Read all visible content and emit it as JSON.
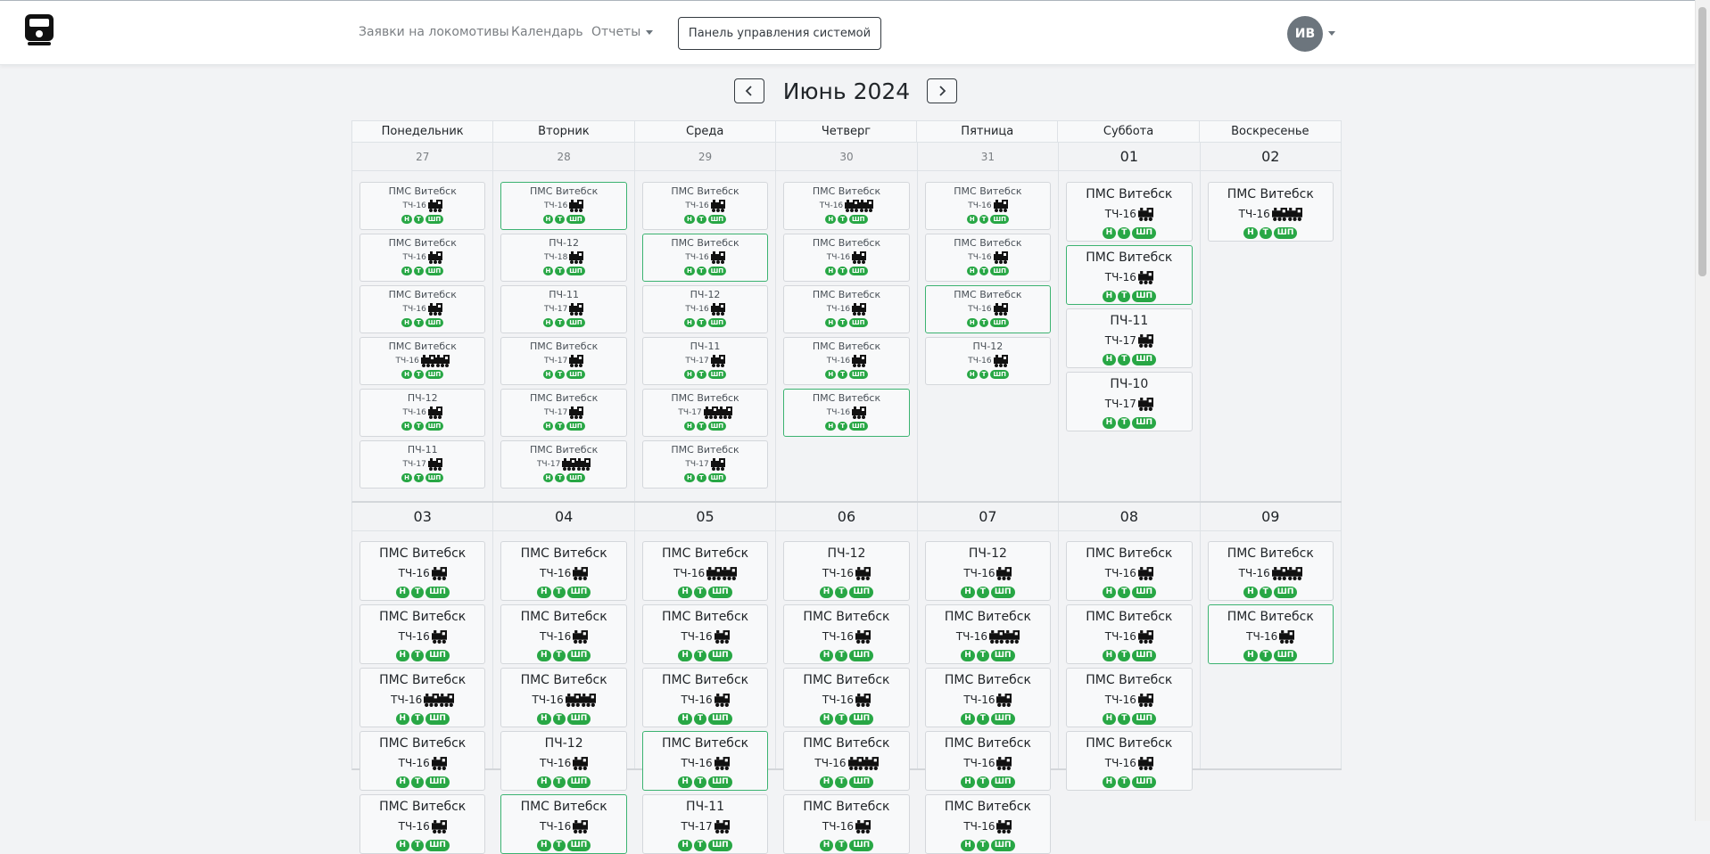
{
  "nav": {
    "links": [
      "Заявки на локомотивы",
      "Календарь",
      "Отчеты"
    ],
    "system_button": "Панель управления системой",
    "avatar": "ИВ",
    "logo_icon": "train-logo-icon"
  },
  "month": {
    "title": "Июнь 2024",
    "prev_icon": "chevron-left-icon",
    "next_icon": "chevron-right-icon"
  },
  "weekdays": [
    "Понедельник",
    "Вторник",
    "Среда",
    "Четверг",
    "Пятница",
    "Суббота",
    "Воскресенье"
  ],
  "badge_labels": [
    "Н",
    "Т",
    "ШП"
  ],
  "colors": {
    "badge": "#28a745",
    "highlight_border": "#3cb371"
  },
  "weeks": [
    {
      "days": [
        {
          "num": "27",
          "other": true,
          "cards": [
            {
              "title": "ПМС Витебск",
              "unit": "ТЧ-16",
              "locos": 1,
              "hl": false
            },
            {
              "title": "ПМС Витебск",
              "unit": "ТЧ-16",
              "locos": 1,
              "hl": false
            },
            {
              "title": "ПМС Витебск",
              "unit": "ТЧ-16",
              "locos": 1,
              "hl": false
            },
            {
              "title": "ПМС Витебск",
              "unit": "ТЧ-16",
              "locos": 2,
              "hl": false
            },
            {
              "title": "ПЧ-12",
              "unit": "ТЧ-16",
              "locos": 1,
              "hl": false
            },
            {
              "title": "ПЧ-11",
              "unit": "ТЧ-17",
              "locos": 1,
              "hl": false
            }
          ]
        },
        {
          "num": "28",
          "other": true,
          "cards": [
            {
              "title": "ПМС Витебск",
              "unit": "ТЧ-16",
              "locos": 1,
              "hl": true
            },
            {
              "title": "ПЧ-12",
              "unit": "ТЧ-18",
              "locos": 1,
              "hl": false
            },
            {
              "title": "ПЧ-11",
              "unit": "ТЧ-17",
              "locos": 1,
              "hl": false
            },
            {
              "title": "ПМС Витебск",
              "unit": "ТЧ-17",
              "locos": 1,
              "hl": false
            },
            {
              "title": "ПМС Витебск",
              "unit": "ТЧ-17",
              "locos": 1,
              "hl": false
            },
            {
              "title": "ПМС Витебск",
              "unit": "ТЧ-17",
              "locos": 2,
              "hl": false
            }
          ]
        },
        {
          "num": "29",
          "other": true,
          "cards": [
            {
              "title": "ПМС Витебск",
              "unit": "ТЧ-16",
              "locos": 1,
              "hl": false
            },
            {
              "title": "ПМС Витебск",
              "unit": "ТЧ-16",
              "locos": 1,
              "hl": true
            },
            {
              "title": "ПЧ-12",
              "unit": "ТЧ-16",
              "locos": 1,
              "hl": false
            },
            {
              "title": "ПЧ-11",
              "unit": "ТЧ-17",
              "locos": 1,
              "hl": false
            },
            {
              "title": "ПМС Витебск",
              "unit": "ТЧ-17",
              "locos": 2,
              "hl": false
            },
            {
              "title": "ПМС Витебск",
              "unit": "ТЧ-17",
              "locos": 1,
              "hl": false
            }
          ]
        },
        {
          "num": "30",
          "other": true,
          "cards": [
            {
              "title": "ПМС Витебск",
              "unit": "ТЧ-16",
              "locos": 2,
              "hl": false
            },
            {
              "title": "ПМС Витебск",
              "unit": "ТЧ-16",
              "locos": 1,
              "hl": false
            },
            {
              "title": "ПМС Витебск",
              "unit": "ТЧ-16",
              "locos": 1,
              "hl": false
            },
            {
              "title": "ПМС Витебск",
              "unit": "ТЧ-16",
              "locos": 1,
              "hl": false
            },
            {
              "title": "ПМС Витебск",
              "unit": "ТЧ-16",
              "locos": 1,
              "hl": true
            }
          ]
        },
        {
          "num": "31",
          "other": true,
          "cards": [
            {
              "title": "ПМС Витебск",
              "unit": "ТЧ-16",
              "locos": 1,
              "hl": false
            },
            {
              "title": "ПМС Витебск",
              "unit": "ТЧ-16",
              "locos": 1,
              "hl": false
            },
            {
              "title": "ПМС Витебск",
              "unit": "ТЧ-16",
              "locos": 1,
              "hl": true
            },
            {
              "title": "ПЧ-12",
              "unit": "ТЧ-16",
              "locos": 1,
              "hl": false
            }
          ]
        },
        {
          "num": "01",
          "other": false,
          "cards": [
            {
              "title": "ПМС Витебск",
              "unit": "ТЧ-16",
              "locos": 1,
              "hl": false
            },
            {
              "title": "ПМС Витебск",
              "unit": "ТЧ-16",
              "locos": 1,
              "hl": true
            },
            {
              "title": "ПЧ-11",
              "unit": "ТЧ-17",
              "locos": 1,
              "hl": false
            },
            {
              "title": "ПЧ-10",
              "unit": "ТЧ-17",
              "locos": 1,
              "hl": false
            }
          ]
        },
        {
          "num": "02",
          "other": false,
          "cards": [
            {
              "title": "ПМС Витебск",
              "unit": "ТЧ-16",
              "locos": 2,
              "hl": false
            }
          ]
        }
      ]
    },
    {
      "days": [
        {
          "num": "03",
          "other": false,
          "cards": [
            {
              "title": "ПМС Витебск",
              "unit": "ТЧ-16",
              "locos": 1,
              "hl": false
            },
            {
              "title": "ПМС Витебск",
              "unit": "ТЧ-16",
              "locos": 1,
              "hl": false
            },
            {
              "title": "ПМС Витебск",
              "unit": "ТЧ-16",
              "locos": 2,
              "hl": false
            },
            {
              "title": "ПМС Витебск",
              "unit": "ТЧ-16",
              "locos": 1,
              "hl": false
            },
            {
              "title": "ПМС Витебск",
              "unit": "ТЧ-16",
              "locos": 1,
              "hl": false
            }
          ]
        },
        {
          "num": "04",
          "other": false,
          "cards": [
            {
              "title": "ПМС Витебск",
              "unit": "ТЧ-16",
              "locos": 1,
              "hl": false
            },
            {
              "title": "ПМС Витебск",
              "unit": "ТЧ-16",
              "locos": 1,
              "hl": false
            },
            {
              "title": "ПМС Витебск",
              "unit": "ТЧ-16",
              "locos": 2,
              "hl": false
            },
            {
              "title": "ПЧ-12",
              "unit": "ТЧ-16",
              "locos": 1,
              "hl": false
            },
            {
              "title": "ПМС Витебск",
              "unit": "ТЧ-16",
              "locos": 1,
              "hl": true
            }
          ]
        },
        {
          "num": "05",
          "other": false,
          "cards": [
            {
              "title": "ПМС Витебск",
              "unit": "ТЧ-16",
              "locos": 2,
              "hl": false
            },
            {
              "title": "ПМС Витебск",
              "unit": "ТЧ-16",
              "locos": 1,
              "hl": false
            },
            {
              "title": "ПМС Витебск",
              "unit": "ТЧ-16",
              "locos": 1,
              "hl": false
            },
            {
              "title": "ПМС Витебск",
              "unit": "ТЧ-16",
              "locos": 1,
              "hl": true
            },
            {
              "title": "ПЧ-11",
              "unit": "ТЧ-17",
              "locos": 1,
              "hl": false
            }
          ]
        },
        {
          "num": "06",
          "other": false,
          "cards": [
            {
              "title": "ПЧ-12",
              "unit": "ТЧ-16",
              "locos": 1,
              "hl": false
            },
            {
              "title": "ПМС Витебск",
              "unit": "ТЧ-16",
              "locos": 1,
              "hl": false
            },
            {
              "title": "ПМС Витебск",
              "unit": "ТЧ-16",
              "locos": 1,
              "hl": false
            },
            {
              "title": "ПМС Витебск",
              "unit": "ТЧ-16",
              "locos": 2,
              "hl": false
            },
            {
              "title": "ПМС Витебск",
              "unit": "ТЧ-16",
              "locos": 1,
              "hl": false
            }
          ]
        },
        {
          "num": "07",
          "other": false,
          "cards": [
            {
              "title": "ПЧ-12",
              "unit": "ТЧ-16",
              "locos": 1,
              "hl": false
            },
            {
              "title": "ПМС Витебск",
              "unit": "ТЧ-16",
              "locos": 2,
              "hl": false
            },
            {
              "title": "ПМС Витебск",
              "unit": "ТЧ-16",
              "locos": 1,
              "hl": false
            },
            {
              "title": "ПМС Витебск",
              "unit": "ТЧ-16",
              "locos": 1,
              "hl": false
            },
            {
              "title": "ПМС Витебск",
              "unit": "ТЧ-16",
              "locos": 1,
              "hl": false
            }
          ]
        },
        {
          "num": "08",
          "other": false,
          "cards": [
            {
              "title": "ПМС Витебск",
              "unit": "ТЧ-16",
              "locos": 1,
              "hl": false
            },
            {
              "title": "ПМС Витебск",
              "unit": "ТЧ-16",
              "locos": 1,
              "hl": false
            },
            {
              "title": "ПМС Витебск",
              "unit": "ТЧ-16",
              "locos": 1,
              "hl": false
            },
            {
              "title": "ПМС Витебск",
              "unit": "ТЧ-16",
              "locos": 1,
              "hl": false
            }
          ]
        },
        {
          "num": "09",
          "other": false,
          "cards": [
            {
              "title": "ПМС Витебск",
              "unit": "ТЧ-16",
              "locos": 2,
              "hl": false
            },
            {
              "title": "ПМС Витебск",
              "unit": "ТЧ-16",
              "locos": 1,
              "hl": true
            }
          ]
        }
      ]
    }
  ]
}
